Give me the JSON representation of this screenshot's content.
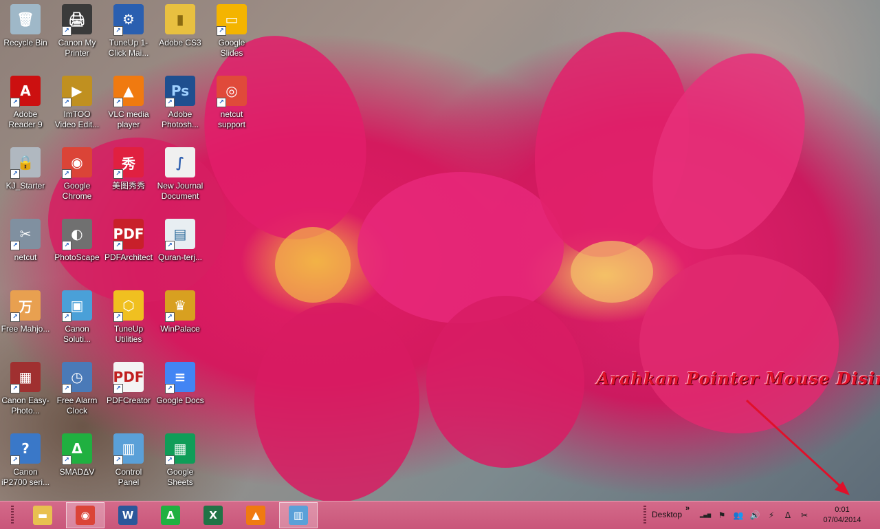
{
  "desktop": {
    "icons": [
      {
        "label": "Recycle Bin",
        "glyph": "🗑",
        "bg": "#9fb8c8",
        "fg": "#ffffff",
        "shortcut": false
      },
      {
        "label": "Canon My Printer",
        "glyph": "🖨",
        "bg": "#3a3a3a",
        "fg": "#ffffff",
        "shortcut": true
      },
      {
        "label": "TuneUp 1-Click Mai...",
        "glyph": "⚙",
        "bg": "#2a5fb0",
        "fg": "#ffffff",
        "shortcut": true
      },
      {
        "label": "Adobe CS3",
        "glyph": "▮",
        "bg": "#e8c040",
        "fg": "#8a6a10",
        "shortcut": false
      },
      {
        "label": "Google Slides",
        "glyph": "▭",
        "bg": "#f4b400",
        "fg": "#ffffff",
        "shortcut": true
      },
      {
        "label": "Adobe Reader 9",
        "glyph": "A",
        "bg": "#cc1010",
        "fg": "#ffffff",
        "shortcut": true
      },
      {
        "label": "ImTOO Video Edit...",
        "glyph": "▶",
        "bg": "#c09020",
        "fg": "#ffffff",
        "shortcut": true
      },
      {
        "label": "VLC media player",
        "glyph": "▲",
        "bg": "#f07a10",
        "fg": "#ffffff",
        "shortcut": true
      },
      {
        "label": "Adobe Photosh...",
        "glyph": "Ps",
        "bg": "#1f4f8f",
        "fg": "#9fd0ff",
        "shortcut": true
      },
      {
        "label": "netcut support",
        "glyph": "◎",
        "bg": "#e04a3a",
        "fg": "#ffffff",
        "shortcut": true
      },
      {
        "label": "KJ_Starter",
        "glyph": "🔒",
        "bg": "#b0b8c0",
        "fg": "#333333",
        "shortcut": true
      },
      {
        "label": "Google Chrome",
        "glyph": "◉",
        "bg": "#db4437",
        "fg": "#ffffff",
        "shortcut": true
      },
      {
        "label": "美图秀秀",
        "glyph": "秀",
        "bg": "#e02040",
        "fg": "#ffffff",
        "shortcut": true
      },
      {
        "label": "New Journal Document",
        "glyph": "∫",
        "bg": "#f0f0f0",
        "fg": "#3060b0",
        "shortcut": false
      },
      {
        "label": "netcut",
        "glyph": "✂",
        "bg": "#8090a0",
        "fg": "#ffffff",
        "shortcut": true
      },
      {
        "label": "PhotoScape",
        "glyph": "◐",
        "bg": "#707070",
        "fg": "#ffffff",
        "shortcut": true
      },
      {
        "label": "PDFArchitect",
        "glyph": "PDF",
        "bg": "#c8202a",
        "fg": "#ffffff",
        "shortcut": true
      },
      {
        "label": "Quran-terj...",
        "glyph": "▤",
        "bg": "#e8eef2",
        "fg": "#2a6a9a",
        "shortcut": true
      },
      {
        "label": "Free Mahjo...",
        "glyph": "万",
        "bg": "#e8a050",
        "fg": "#ffffff",
        "shortcut": true
      },
      {
        "label": "Canon Soluti...",
        "glyph": "▣",
        "bg": "#4aa0d8",
        "fg": "#ffffff",
        "shortcut": true
      },
      {
        "label": "TuneUp Utilities",
        "glyph": "⬡",
        "bg": "#f0c020",
        "fg": "#ffffff",
        "shortcut": true
      },
      {
        "label": "WinPalace",
        "glyph": "♛",
        "bg": "#d8a020",
        "fg": "#ffffff",
        "shortcut": true
      },
      {
        "label": "Canon Easy-Photo...",
        "glyph": "▦",
        "bg": "#a03030",
        "fg": "#ffffff",
        "shortcut": true
      },
      {
        "label": "Free Alarm Clock",
        "glyph": "◷",
        "bg": "#4a7ab8",
        "fg": "#ffffff",
        "shortcut": true
      },
      {
        "label": "PDFCreator",
        "glyph": "PDF",
        "bg": "#f4f4f4",
        "fg": "#c02020",
        "shortcut": true
      },
      {
        "label": "Google Docs",
        "glyph": "≡",
        "bg": "#4285f4",
        "fg": "#ffffff",
        "shortcut": true
      },
      {
        "label": "Canon iP2700 seri...",
        "glyph": "?",
        "bg": "#3a78c8",
        "fg": "#ffffff",
        "shortcut": true
      },
      {
        "label": "SMADΔV",
        "glyph": "Δ",
        "bg": "#20b040",
        "fg": "#ffffff",
        "shortcut": true
      },
      {
        "label": "Control Panel",
        "glyph": "▥",
        "bg": "#5aa0d8",
        "fg": "#ffffff",
        "shortcut": true
      },
      {
        "label": "Google Sheets",
        "glyph": "▦",
        "bg": "#0f9d58",
        "fg": "#ffffff",
        "shortcut": true
      }
    ]
  },
  "annotation": {
    "text": "Arahkan Pointer Mouse Disini",
    "color": "#e0102a"
  },
  "taskbar": {
    "pinned": [
      {
        "name": "file-explorer",
        "glyph": "▬",
        "bg": "#e8c050",
        "active": false
      },
      {
        "name": "google-chrome",
        "glyph": "◉",
        "bg": "#db4437",
        "active": true
      },
      {
        "name": "microsoft-word",
        "glyph": "W",
        "bg": "#2b579a",
        "active": false
      },
      {
        "name": "smadav",
        "glyph": "Δ",
        "bg": "#20b040",
        "active": false
      },
      {
        "name": "microsoft-excel",
        "glyph": "X",
        "bg": "#217346",
        "active": false
      },
      {
        "name": "vlc-media-player",
        "glyph": "▲",
        "bg": "#f07a10",
        "active": false
      },
      {
        "name": "control-panel",
        "glyph": "▥",
        "bg": "#5aa0d8",
        "active": true
      }
    ],
    "toolbar_label": "Desktop",
    "chevron": "»",
    "tray": [
      {
        "name": "signal-icon",
        "glyph": "▂▄▆"
      },
      {
        "name": "flag-icon",
        "glyph": "⚑"
      },
      {
        "name": "network-users-icon",
        "glyph": "👥"
      },
      {
        "name": "volume-icon",
        "glyph": "🔊"
      },
      {
        "name": "power-plug-icon",
        "glyph": "⚡"
      },
      {
        "name": "smadav-tray-icon",
        "glyph": "Δ"
      },
      {
        "name": "netcut-tray-icon",
        "glyph": "✂"
      }
    ],
    "clock": {
      "time": "0:01",
      "date": "07/04/2014"
    }
  }
}
